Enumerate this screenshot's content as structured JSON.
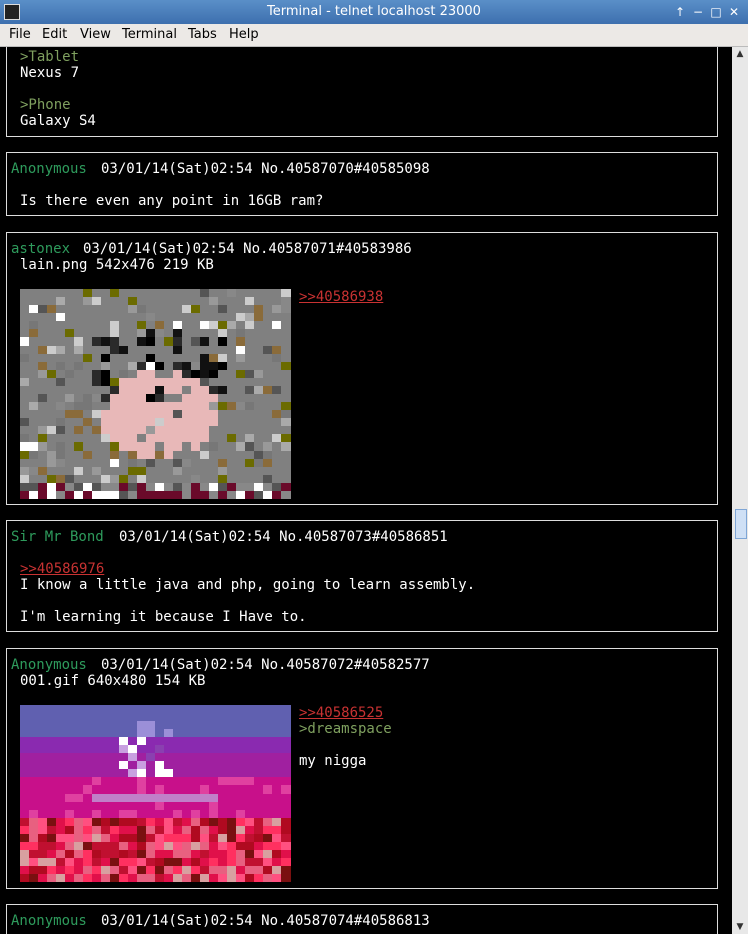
{
  "window": {
    "title": "Terminal - telnet localhost 23000"
  },
  "menu": [
    "File",
    "Edit",
    "View",
    "Terminal",
    "Tabs",
    "Help"
  ],
  "posts": {
    "p0": {
      "l1": ">Tablet",
      "l2": "Nexus 7",
      "l3": ">Phone",
      "l4": "Galaxy S4"
    },
    "p1": {
      "name": "Anonymous",
      "meta": "03/01/14(Sat)02:54 No.40587070#40585098",
      "body": "Is there even any point in 16GB ram?"
    },
    "p2": {
      "name": "astonex",
      "meta": "03/01/14(Sat)02:54 No.40587071#40583986",
      "file": "lain.png 542x476 219 KB",
      "reply": ">>40586938"
    },
    "p3": {
      "name": "Sir Mr Bond",
      "meta": "03/01/14(Sat)02:54 No.40587073#40586851",
      "reply": ">>40586976",
      "body1": "I know a little java and php, going to learn assembly.",
      "body2": "I'm learning it because I Have to."
    },
    "p4": {
      "name": "Anonymous",
      "meta": "03/01/14(Sat)02:54 No.40587072#40582577",
      "file": "001.gif 640x480 154 KB",
      "reply": ">>40586525",
      "green": ">dreamspace",
      "body": "my nigga"
    },
    "p5": {
      "name": "Anonymous",
      "meta": "03/01/14(Sat)02:54 No.40587074#40586813"
    }
  }
}
